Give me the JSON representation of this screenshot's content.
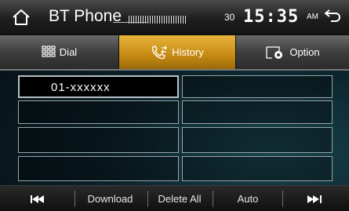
{
  "header": {
    "title": "BT Phone",
    "volume": "30",
    "clock": "15:35",
    "ampm": "AM",
    "home_icon": "home-icon",
    "back_icon": "back-arrow-icon"
  },
  "tabs": [
    {
      "label": "Dial",
      "icon": "dialpad-icon",
      "active": false
    },
    {
      "label": "History",
      "icon": "call-history-icon",
      "active": true
    },
    {
      "label": "Option",
      "icon": "gear-icon",
      "active": false
    }
  ],
  "history": {
    "left": [
      "01-xxxxxx",
      "",
      "",
      ""
    ],
    "right": [
      "",
      "",
      "",
      ""
    ]
  },
  "bottom": {
    "prev_icon": "skip-previous-icon",
    "download": "Download",
    "delete_all": "Delete All",
    "auto": "Auto",
    "next_icon": "skip-next-icon"
  },
  "colors": {
    "active_tab": "#d9a024",
    "header": "#2a2a2a"
  }
}
